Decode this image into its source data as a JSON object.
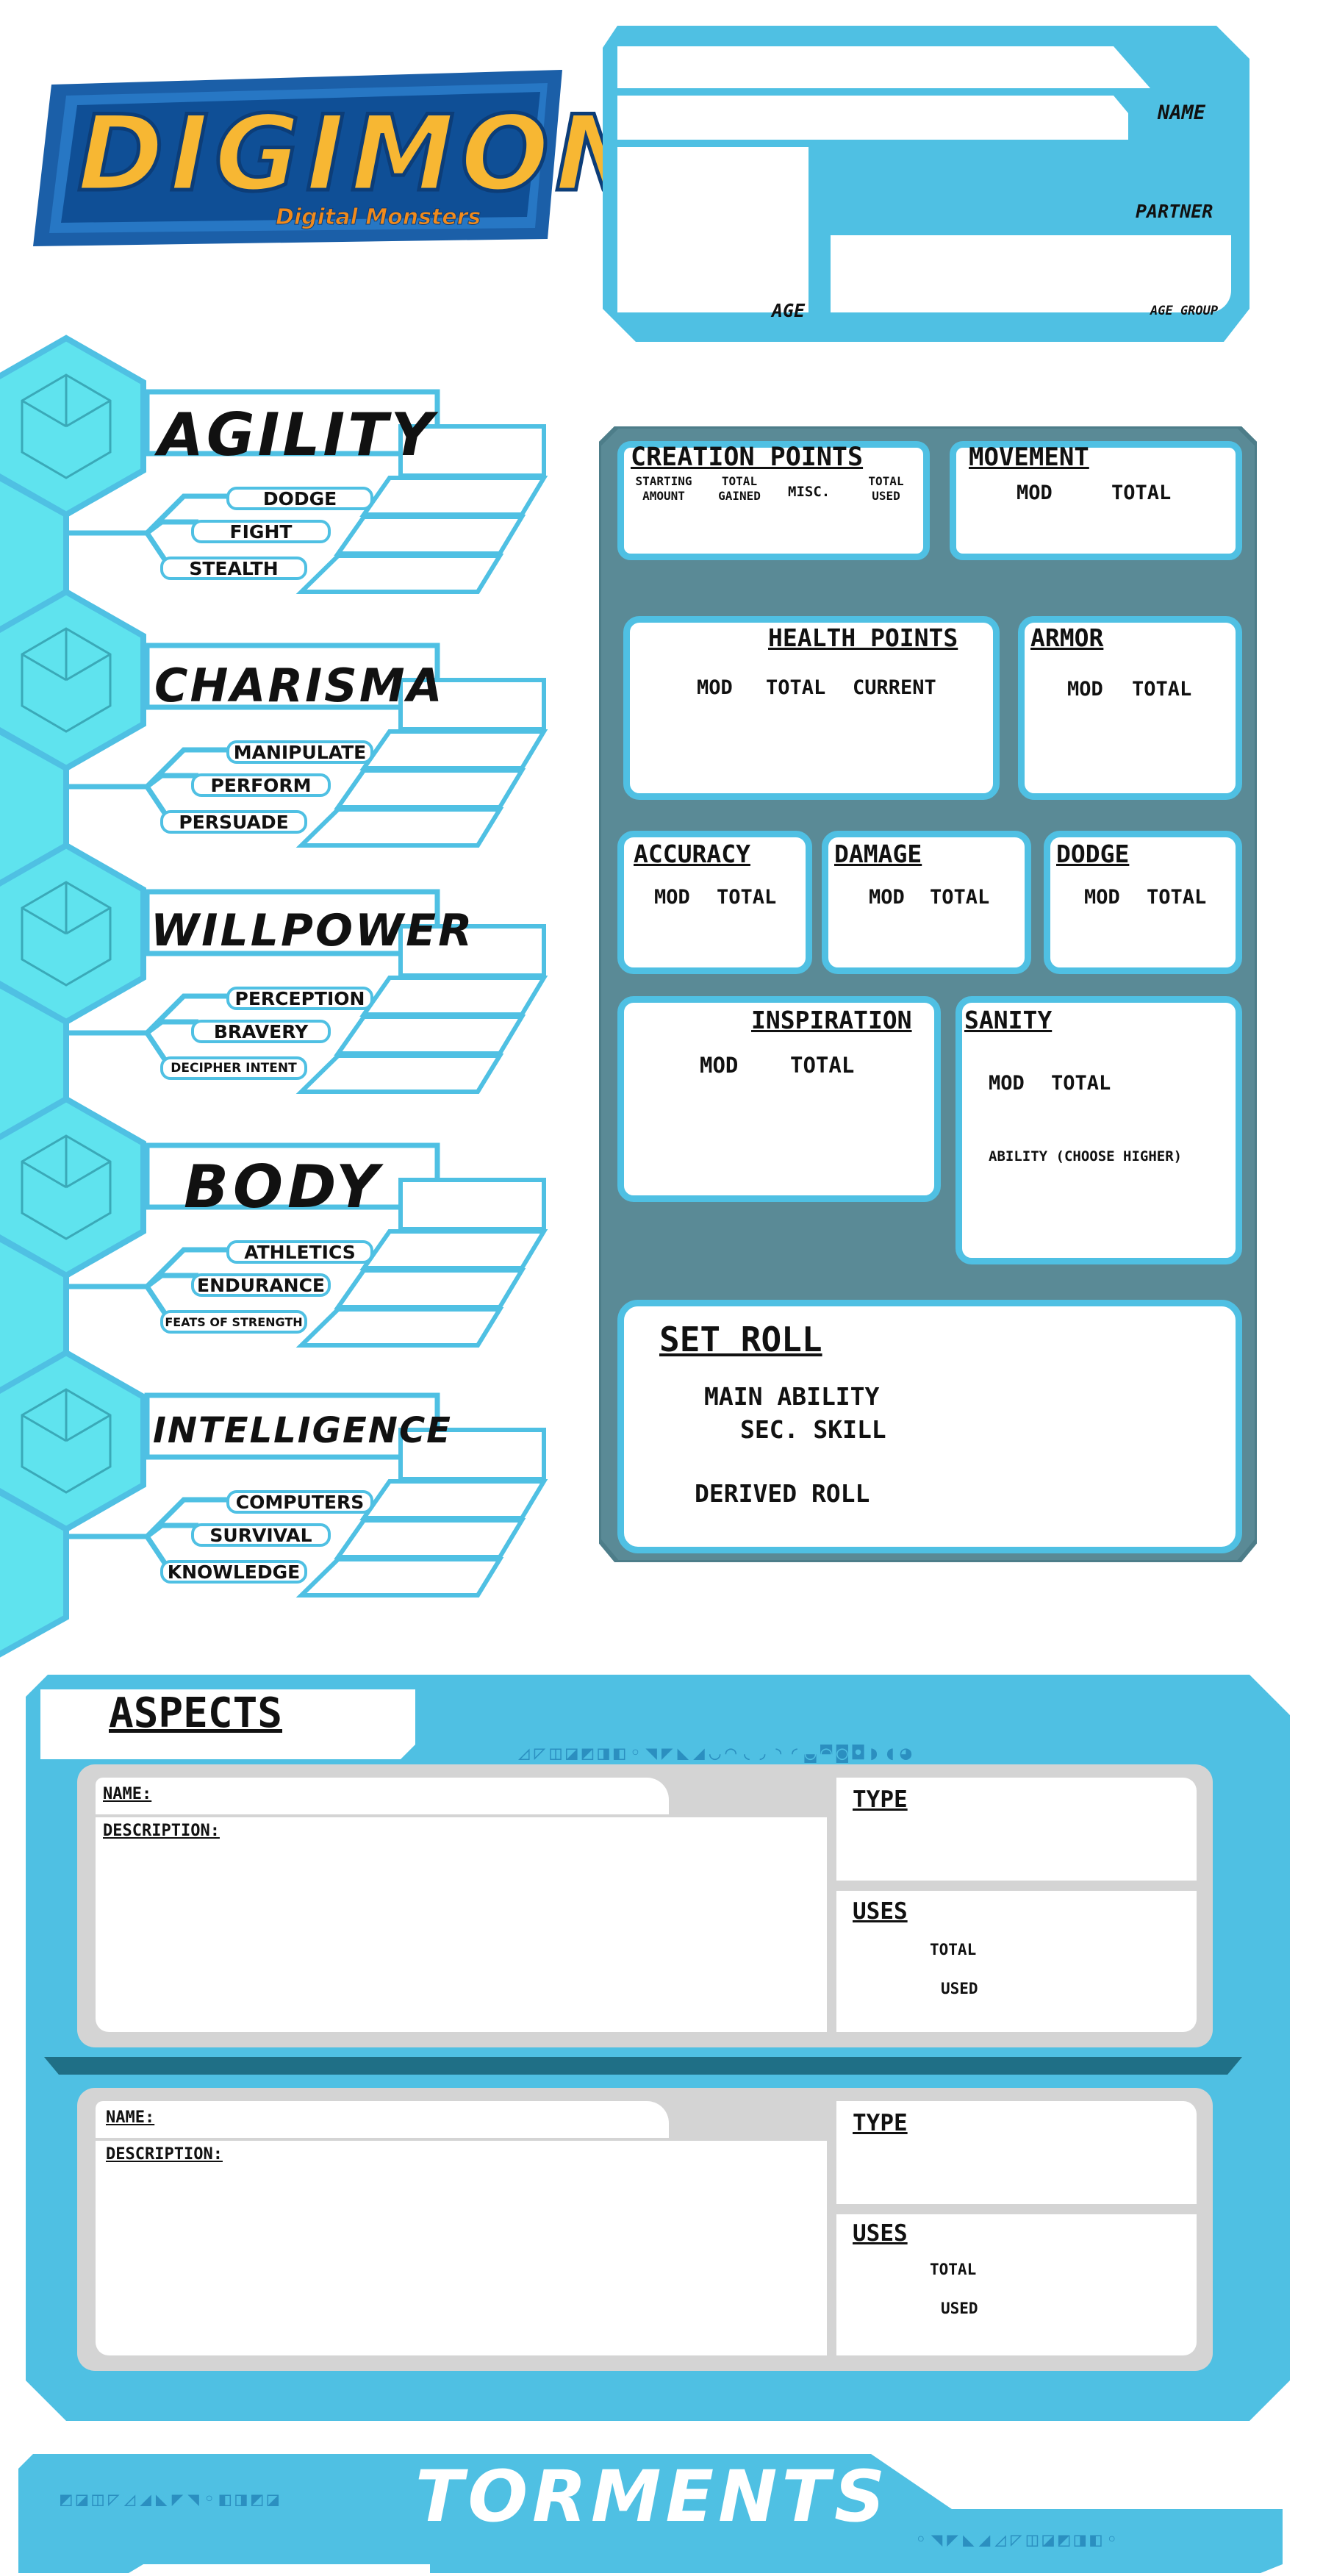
{
  "logo": {
    "title": "DIGIMON",
    "subtitle": "Digital Monsters"
  },
  "identity": {
    "name_label": "NAME",
    "partner_label": "PARTNER",
    "age_label": "AGE",
    "age_group_label": "AGE GROUP"
  },
  "abilities": [
    {
      "name": "AGILITY",
      "skills": [
        "DODGE",
        "FIGHT",
        "STEALTH"
      ]
    },
    {
      "name": "CHARISMA",
      "skills": [
        "MANIPULATE",
        "PERFORM",
        "PERSUADE"
      ]
    },
    {
      "name": "WILLPOWER",
      "skills": [
        "PERCEPTION",
        "BRAVERY",
        "DECIPHER INTENT"
      ]
    },
    {
      "name": "BODY",
      "skills": [
        "ATHLETICS",
        "ENDURANCE",
        "FEATS OF STRENGTH"
      ]
    },
    {
      "name": "INTELLIGENCE",
      "skills": [
        "COMPUTERS",
        "SURVIVAL",
        "KNOWLEDGE"
      ]
    }
  ],
  "stats": {
    "creation_points": {
      "title": "CREATION POINTS",
      "cols": [
        "STARTING AMOUNT",
        "TOTAL GAINED",
        "MISC.",
        "TOTAL USED"
      ]
    },
    "movement": {
      "title": "MOVEMENT",
      "mod": "MOD",
      "total": "TOTAL"
    },
    "health": {
      "title": "HEALTH POINTS",
      "mod": "MOD",
      "total": "TOTAL",
      "current": "CURRENT"
    },
    "armor": {
      "title": "ARMOR",
      "mod": "MOD",
      "total": "TOTAL"
    },
    "accuracy": {
      "title": "ACCURACY",
      "mod": "MOD",
      "total": "TOTAL"
    },
    "damage": {
      "title": "DAMAGE",
      "mod": "MOD",
      "total": "TOTAL"
    },
    "dodge": {
      "title": "DODGE",
      "mod": "MOD",
      "total": "TOTAL"
    },
    "inspiration": {
      "title": "INSPIRATION",
      "mod": "MOD",
      "total": "TOTAL"
    },
    "sanity": {
      "title": "SANITY",
      "mod": "MOD",
      "total": "TOTAL",
      "note": "ABILITY (CHOOSE HIGHER)"
    },
    "set_roll": {
      "title": "SET ROLL",
      "main": "MAIN ABILITY",
      "sec": "SEC. SKILL",
      "derived": "DERIVED ROLL"
    }
  },
  "aspects": {
    "title": "ASPECTS",
    "cards": [
      {
        "name_label": "NAME:",
        "desc_label": "DESCRIPTION:",
        "type_label": "TYPE",
        "uses_label": "USES",
        "total_label": "TOTAL",
        "used_label": "USED"
      },
      {
        "name_label": "NAME:",
        "desc_label": "DESCRIPTION:",
        "type_label": "TYPE",
        "uses_label": "USES",
        "total_label": "TOTAL",
        "used_label": "USED"
      }
    ]
  },
  "torments": {
    "title": "TORMENTS"
  },
  "colors": {
    "accent": "#4fc0e3",
    "dark_panel": "#5a8a96",
    "hex": "#5fe3ee",
    "card_gray": "#d4d4d4",
    "divider": "#1f6f86"
  }
}
